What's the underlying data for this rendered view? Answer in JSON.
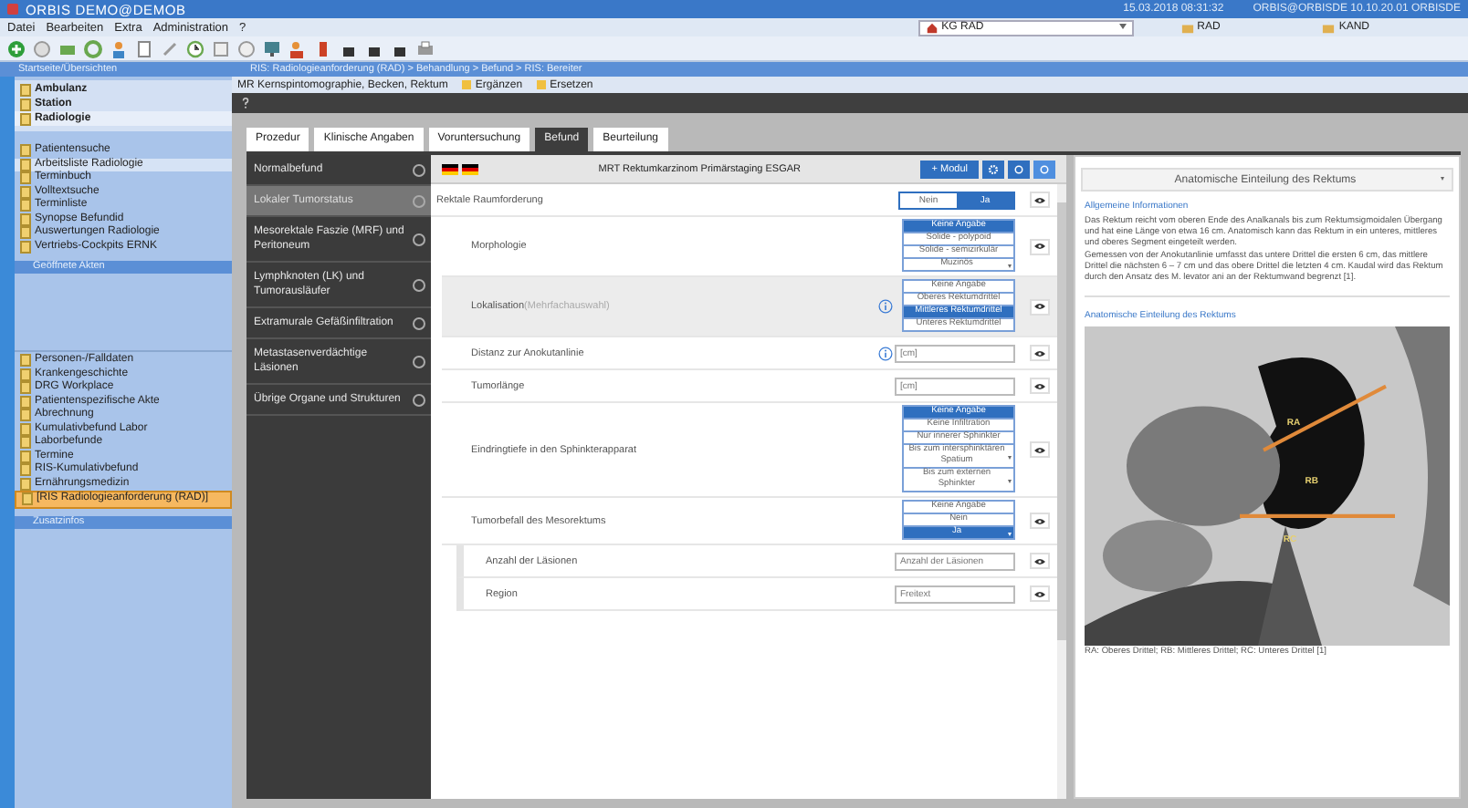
{
  "window": {
    "title": "ORBIS DEMO@DEMOB",
    "datetime": "15.03.2018 08:31:32",
    "session": "ORBIS@ORBISDE 10.10.20.01 ORBISDE"
  },
  "menu": [
    "Datei",
    "Bearbeiten",
    "Extra",
    "Administration",
    "?"
  ],
  "toolbar": {
    "dropdown": "KG RAD",
    "links": [
      "RAD",
      "KAND"
    ]
  },
  "sidebar": {
    "header": "Startseite/Übersichten",
    "groups": [
      {
        "label": "Ambulanz",
        "selected": false
      },
      {
        "label": "Station",
        "selected": false
      },
      {
        "label": "Radiologie",
        "selected": true
      }
    ],
    "worklists": [
      {
        "label": "Patientensuche",
        "selected": false
      },
      {
        "label": "Arbeitsliste Radiologie",
        "selected": true
      },
      {
        "label": "Terminbuch",
        "selected": false
      },
      {
        "label": "Volltextsuche",
        "selected": false
      },
      {
        "label": "Terminliste",
        "selected": false
      },
      {
        "label": "Synopse Befundid",
        "selected": false
      },
      {
        "label": "Auswertungen Radiologie",
        "selected": false
      },
      {
        "label": "Vertriebs-Cockpits ERNK",
        "selected": false
      }
    ],
    "open_header": "Geöffnete Akten",
    "records": [
      {
        "label": "Personen-/Falldaten",
        "selected": false
      },
      {
        "label": "Krankengeschichte",
        "selected": false
      },
      {
        "label": "DRG Workplace",
        "selected": false
      },
      {
        "label": "Patientenspezifische Akte",
        "selected": false
      },
      {
        "label": "Abrechnung",
        "selected": false
      },
      {
        "label": "Kumulativbefund Labor",
        "selected": false
      },
      {
        "label": "Laborbefunde",
        "selected": false
      },
      {
        "label": "Termine",
        "selected": false
      },
      {
        "label": "RIS-Kumulativbefund",
        "selected": false
      },
      {
        "label": "Ernährungsmedizin",
        "selected": false
      },
      {
        "label": "[RIS Radiologieanforderung (RAD)]",
        "selected": true
      }
    ],
    "extra_header": "Zusatzinfos"
  },
  "breadcrumb": "RIS: Radiologieanforderung (RAD) > Behandlung > Befund > RIS: Bereiter",
  "document": {
    "title": "MR Kernspintomographie, Becken, Rektum",
    "actions": [
      "Ergänzen",
      "Ersetzen"
    ]
  },
  "tabs": [
    {
      "label": "Prozedur",
      "selected": false
    },
    {
      "label": "Klinische Angaben",
      "selected": false
    },
    {
      "label": "Voruntersuchung",
      "selected": false
    },
    {
      "label": "Befund",
      "selected": true
    },
    {
      "label": "Beurteilung",
      "selected": false
    }
  ],
  "sections": [
    {
      "label": "Normalbefund",
      "selected": false
    },
    {
      "label": "Lokaler Tumorstatus",
      "selected": true
    },
    {
      "label": "Mesorektale Faszie (MRF) und Peritoneum",
      "selected": false
    },
    {
      "label": "Lymphknoten (LK) und Tumorausläufer",
      "selected": false
    },
    {
      "label": "Extramurale Gefäßinfiltration",
      "selected": false
    },
    {
      "label": "Metastasenverdächtige Läsionen",
      "selected": false
    },
    {
      "label": "Übrige Organe und Strukturen",
      "selected": false
    }
  ],
  "form": {
    "title": "MRT Rektumkarzinom Primärstaging ESGAR",
    "add_button": "+ Modul",
    "rows": [
      {
        "kind": "toggle",
        "label": "Rektale Raumforderung",
        "shaded": false,
        "info": false,
        "options": [
          {
            "label": "Nein",
            "selected": false
          },
          {
            "label": "Ja",
            "selected": true
          }
        ]
      },
      {
        "kind": "choice",
        "label": "Morphologie",
        "shaded": false,
        "info": false,
        "options": [
          {
            "label": "Keine Angabe",
            "selected": true,
            "expandable": false
          },
          {
            "label": "Solide - polypoid",
            "selected": false,
            "expandable": false
          },
          {
            "label": "Solide - semizirkulär",
            "selected": false,
            "expandable": false
          },
          {
            "label": "Muzinös",
            "selected": false,
            "expandable": true
          }
        ]
      },
      {
        "kind": "choice",
        "label": "Lokalisation",
        "hint": "(Mehrfachauswahl)",
        "shaded": true,
        "info": true,
        "options": [
          {
            "label": "Keine Angabe",
            "selected": false,
            "expandable": false
          },
          {
            "label": "Oberes Rektumdrittel",
            "selected": false,
            "expandable": false
          },
          {
            "label": "Mittleres Rektumdrittel",
            "selected": true,
            "expandable": false
          },
          {
            "label": "Unteres Rektumdrittel",
            "selected": false,
            "expandable": false
          }
        ]
      },
      {
        "kind": "field",
        "label": "Distanz zur Anokutanlinie",
        "shaded": false,
        "info": true,
        "placeholder": "[cm]"
      },
      {
        "kind": "field",
        "label": "Tumorlänge",
        "shaded": false,
        "info": false,
        "placeholder": "[cm]"
      },
      {
        "kind": "choice",
        "label": "Eindringtiefe in den Sphinkterapparat",
        "shaded": false,
        "info": false,
        "options": [
          {
            "label": "Keine Angabe",
            "selected": true,
            "expandable": false
          },
          {
            "label": "Keine Infiltration",
            "selected": false,
            "expandable": false
          },
          {
            "label": "Nur innerer Sphinkter",
            "selected": false,
            "expandable": false
          },
          {
            "label": "Bis zum intersphinktären Spatium",
            "selected": false,
            "expandable": true
          },
          {
            "label": "Bis zum externen Sphinkter",
            "selected": false,
            "expandable": true
          }
        ]
      },
      {
        "kind": "choice",
        "label": "Tumorbefall des Mesorektums",
        "shaded": false,
        "info": false,
        "options": [
          {
            "label": "Keine Angabe",
            "selected": false,
            "expandable": false
          },
          {
            "label": "Nein",
            "selected": false,
            "expandable": false
          },
          {
            "label": "Ja",
            "selected": true,
            "expandable": true
          }
        ],
        "children": [
          {
            "kind": "field",
            "label": "Anzahl der Läsionen",
            "placeholder": "Anzahl der Läsionen"
          },
          {
            "kind": "field",
            "label": "Region",
            "placeholder": "Freitext"
          }
        ]
      }
    ]
  },
  "info_panel": {
    "title": "Anatomische Einteilung des Rektums",
    "section": "Allgemeine Informationen",
    "paragraphs": [
      "Das Rektum reicht vom oberen Ende des Analkanals bis zum Rektumsigmoidalen Übergang und hat eine Länge von etwa 16 cm. Anatomisch kann das Rektum in ein unteres, mittleres und oberes Segment eingeteilt werden.",
      "Gemessen von der Anokutanlinie umfasst das untere Drittel die ersten 6 cm, das mittlere Drittel die nächsten 6 – 7 cm und das obere Drittel die letzten 4 cm. Kaudal wird das Rektum durch den Ansatz des M. levator ani an der Rektumwand begrenzt [1]."
    ],
    "figure_title": "Anatomische Einteilung des Rektums",
    "figure_labels": [
      "RA",
      "RB",
      "RC"
    ],
    "caption": "RA: Oberes Drittel; RB: Mittleres Drittel; RC: Unteres Drittel [1]"
  }
}
